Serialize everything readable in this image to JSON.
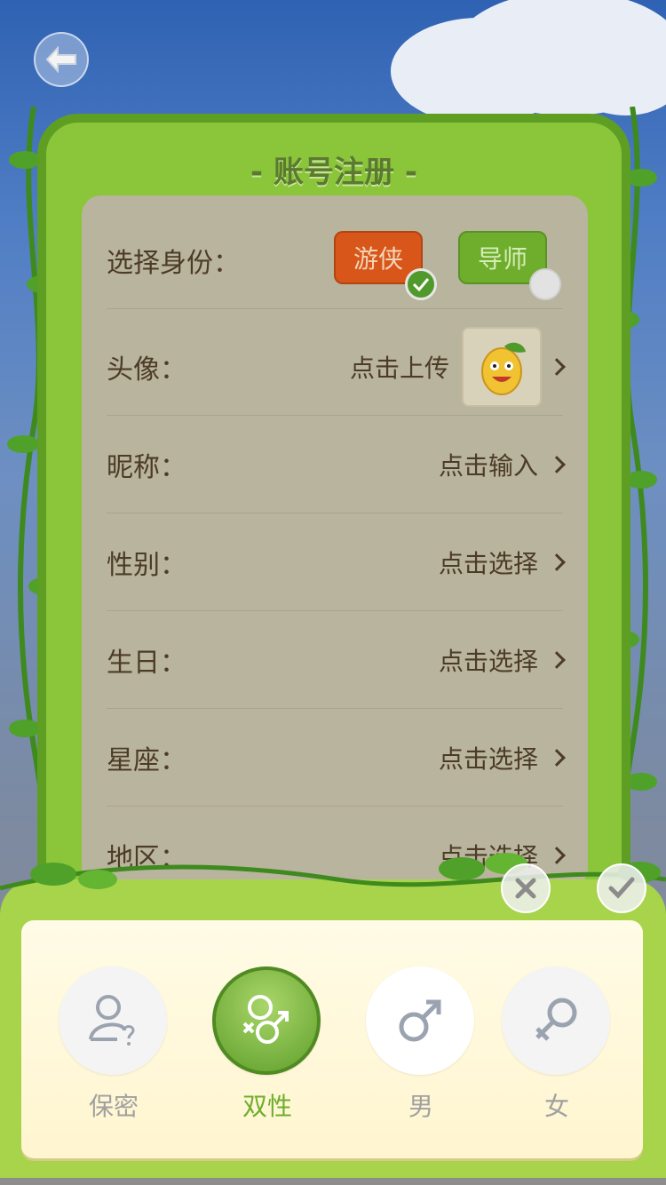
{
  "header": {
    "back_icon": "back-arrow-icon"
  },
  "board": {
    "title": "- 账号注册 -"
  },
  "form": {
    "identity": {
      "label": "选择身份：",
      "options": [
        "游侠",
        "导师"
      ],
      "selected": "游侠"
    },
    "avatar": {
      "label": "头像：",
      "value": "点击上传",
      "icon": "lemon-avatar-icon"
    },
    "nickname": {
      "label": "昵称：",
      "value": "点击输入"
    },
    "gender": {
      "label": "性别：",
      "value": "点击选择"
    },
    "birthday": {
      "label": "生日：",
      "value": "点击选择"
    },
    "constellation": {
      "label": "星座：",
      "value": "点击选择"
    },
    "region": {
      "label": "地区：",
      "value": "点击选择"
    }
  },
  "actions": {
    "cancel_icon": "close-icon",
    "confirm_icon": "check-icon"
  },
  "gender_picker": {
    "options": [
      {
        "label": "保密",
        "icon": "secret-person-icon"
      },
      {
        "label": "双性",
        "icon": "bisexual-icon"
      },
      {
        "label": "男",
        "icon": "male-icon"
      },
      {
        "label": "女",
        "icon": "female-icon"
      }
    ],
    "selected": "双性"
  },
  "colors": {
    "board_green": "#8ac53a",
    "selected_orange": "#d8561a",
    "selected_green": "#6fae2d",
    "text_brown": "#4c3b27"
  }
}
